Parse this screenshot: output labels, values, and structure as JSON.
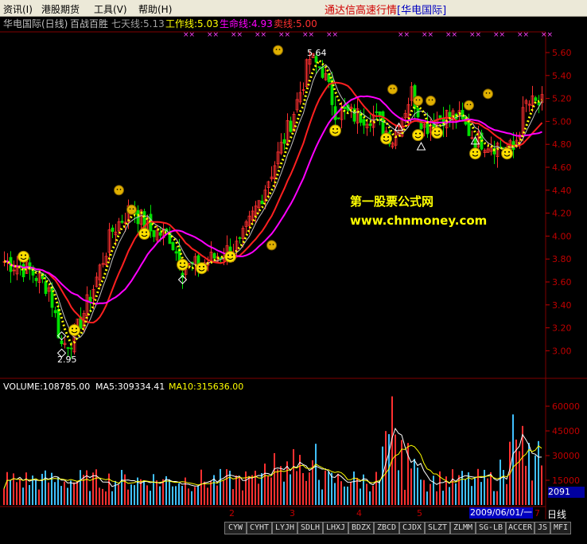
{
  "menu": {
    "items": [
      "资讯(I)",
      "港股期货",
      "工具(V)",
      "帮助(H)"
    ],
    "title": "通达信高速行情",
    "host": "[华电国际]"
  },
  "chart_header": {
    "stock": "华电国际(日线)",
    "indicator": "百战百胜",
    "ma7": "七天线:5.13",
    "work": "工作线:5.03",
    "life": "生命线:4.93",
    "sell": "卖线:5.00",
    "colors": {
      "ma7": "#c0c0c0",
      "work": "#ffff00",
      "life": "#ff00ff",
      "sell": "#ff3030"
    }
  },
  "watermark": {
    "line1": "第一股票公式网",
    "line2": "www.chnmoney.com",
    "color": "#ffff00"
  },
  "price_axis": {
    "ticks": [
      "5.60",
      "5.40",
      "5.20",
      "5.00",
      "4.80",
      "4.60",
      "4.40",
      "4.20",
      "4.00",
      "3.80",
      "3.60",
      "3.40",
      "3.20",
      "3.00"
    ]
  },
  "annotations": {
    "high": "5.64",
    "low": "2.95"
  },
  "volume_header": {
    "volume": "VOLUME:108785.00",
    "ma5": "MA5:309334.41",
    "ma10": "MA10:315636.00"
  },
  "volume_axis": {
    "ticks": [
      "60000",
      "45000",
      "30000",
      "15000"
    ]
  },
  "month_labels": [
    "2",
    "3",
    "4",
    "5",
    "7"
  ],
  "current_price": "2091",
  "date_label": "2009/06/01/一",
  "period": "日线",
  "tabs": [
    "CYW",
    "CYHT",
    "LYJH",
    "SDLH",
    "LHXJ",
    "BDZX",
    "ZBCD",
    "CJDX",
    "SLZT",
    "ZLMM",
    "SG-LB",
    "ACCER",
    "JS",
    "MFI"
  ]
}
